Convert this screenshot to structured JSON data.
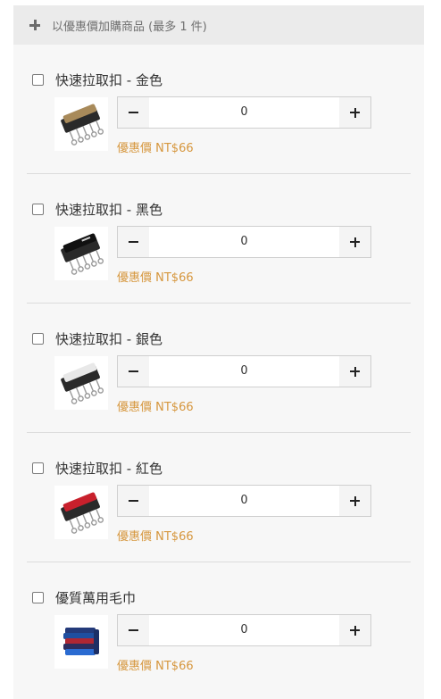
{
  "header": {
    "label": "以優惠價加購商品 (最多 1 件)",
    "icon": "plus-icon"
  },
  "colors": {
    "price": "#d6963c",
    "header_bg": "#ebebeb",
    "panel_bg": "#f7f7f7"
  },
  "items": [
    {
      "name": "快速拉取扣 - 金色",
      "quantity": "0",
      "price": "優惠價 NT$66",
      "thumbnail": "gold-buckle-thumbnail"
    },
    {
      "name": "快速拉取扣 - 黑色",
      "quantity": "0",
      "price": "優惠價 NT$66",
      "thumbnail": "black-buckle-thumbnail"
    },
    {
      "name": "快速拉取扣 - 銀色",
      "quantity": "0",
      "price": "優惠價 NT$66",
      "thumbnail": "silver-buckle-thumbnail"
    },
    {
      "name": "快速拉取扣 - 紅色",
      "quantity": "0",
      "price": "優惠價 NT$66",
      "thumbnail": "red-buckle-thumbnail"
    },
    {
      "name": "優質萬用毛巾",
      "quantity": "0",
      "price": "優惠價 NT$66",
      "thumbnail": "towels-thumbnail"
    }
  ]
}
